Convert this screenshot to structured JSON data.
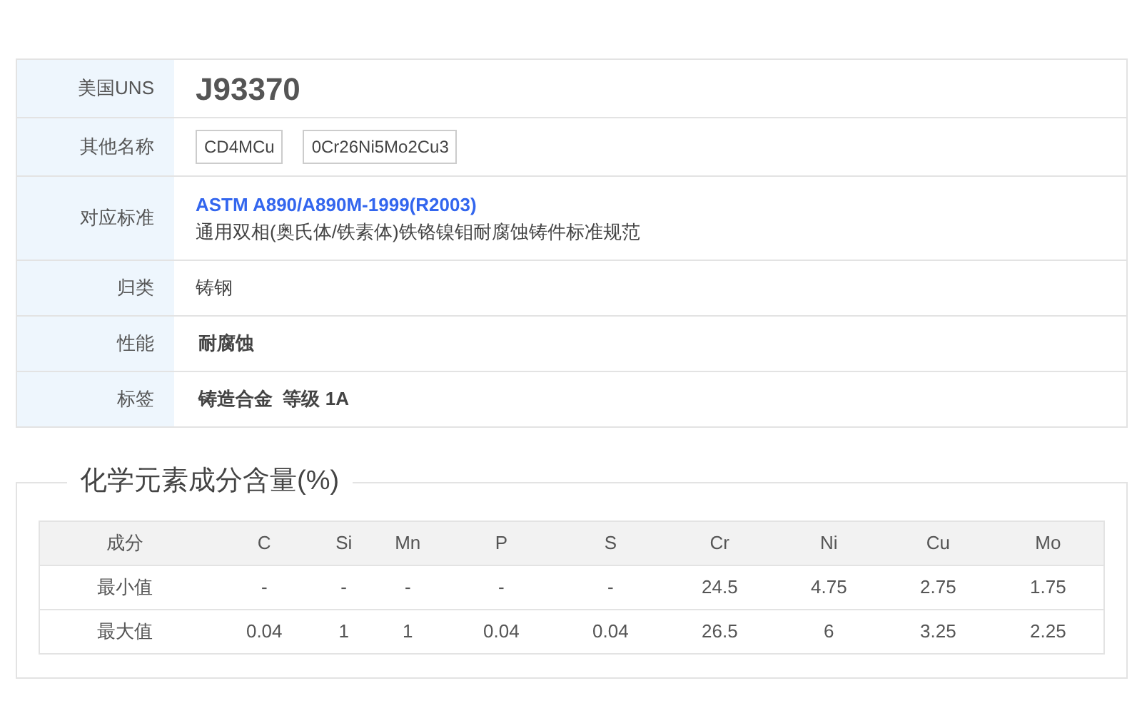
{
  "properties": [
    {
      "label": "美国UNS",
      "kind": "title",
      "value": "J93370"
    },
    {
      "label": "其他名称",
      "kind": "tags",
      "tags": [
        "CD4MCu",
        "0Cr26Ni5Mo2Cu3"
      ]
    },
    {
      "label": "对应标准",
      "kind": "standard",
      "link": "ASTM A890/A890M-1999(R2003)",
      "value": "通用双相(奥氏体/铁素体)铁铬镍钼耐腐蚀铸件标准规范"
    },
    {
      "label": "归类",
      "kind": "text",
      "value": "铸钢"
    },
    {
      "label": "性能",
      "kind": "bold",
      "value": "耐腐蚀"
    },
    {
      "label": "标签",
      "kind": "bold",
      "value": "铸造合金  等级 1A"
    }
  ],
  "composition": {
    "title": "化学元素成分含量(%)",
    "columns": [
      "成分",
      "C",
      "Si",
      "Mn",
      "P",
      "S",
      "Cr",
      "Ni",
      "Cu",
      "Mo"
    ],
    "rows": [
      [
        "最小值",
        "-",
        "-",
        "-",
        "-",
        "-",
        "24.5",
        "4.75",
        "2.75",
        "1.75"
      ],
      [
        "最大值",
        "0.04",
        "1",
        "1",
        "0.04",
        "0.04",
        "26.5",
        "6",
        "3.25",
        "2.25"
      ]
    ]
  }
}
